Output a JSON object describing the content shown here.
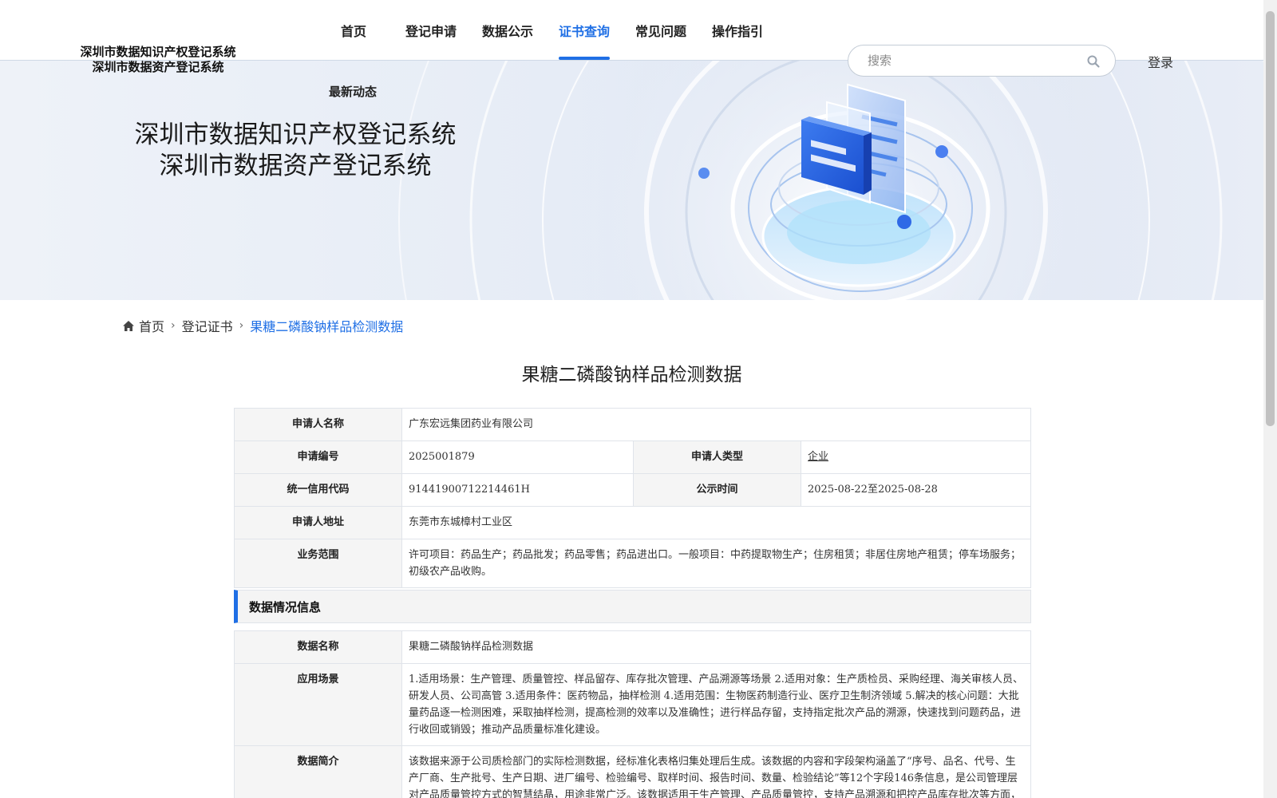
{
  "header": {
    "logo_line1": "深圳市数据知识产权登记系统",
    "logo_line2": "深圳市数据资产登记系统",
    "nav": [
      "首页",
      "登记申请",
      "数据公示",
      "证书查询",
      "常见问题",
      "操作指引"
    ],
    "nav_sub": "最新动态",
    "active_nav": "证书查询",
    "search_placeholder": "搜索",
    "login_label": "登录",
    "accent_color": "#1f6fe5"
  },
  "banner": {
    "title_line1": "深圳市数据知识产权登记系统",
    "title_line2": "深圳市数据资产登记系统"
  },
  "breadcrumb": {
    "home": "首页",
    "level2": "登记证书",
    "current": "果糖二磷酸钠样品检测数据"
  },
  "page_title": "果糖二磷酸钠样品检测数据",
  "applicant": {
    "name_label": "申请人名称",
    "name_value": "广东宏远集团药业有限公司",
    "number_label": "申请编号",
    "number_value": "2025001879",
    "type_label": "申请人类型",
    "type_value": "企业",
    "credit_label": "统一信用代码",
    "credit_value": "91441900712214461H",
    "publicity_label": "公示时间",
    "publicity_value": "2025-08-22至2025-08-28",
    "address_label": "申请人地址",
    "address_value": "东莞市东城樟村工业区",
    "scope_label": "业务范围",
    "scope_value": "许可项目：药品生产；药品批发；药品零售；药品进出口。一般项目：中药提取物生产；住房租赁；非居住房地产租赁；停车场服务；初级农产品收购。"
  },
  "data_section": {
    "heading": "数据情况信息",
    "name_label": "数据名称",
    "name_value": "果糖二磷酸钠样品检测数据",
    "scenario_label": "应用场景",
    "scenario_value": "1.适用场景：生产管理、质量管控、样品留存、库存批次管理、产品溯源等场景 2.适用对象：生产质检员、采购经理、海关审核人员、研发人员、公司高管 3.适用条件：医药物品，抽样检测 4.适用范围：生物医药制造行业、医疗卫生制济领域 5.解决的核心问题：大批量药品逐一检测困难，采取抽样检测，提高检测的效率以及准确性；进行样品存留，支持指定批次产品的溯源，快速找到问题药品，进行收回或销毁；推动产品质量标准化建设。",
    "intro_label": "数据简介",
    "intro_value": "该数据来源于公司质检部门的实际检测数据，经标准化表格归集处理后生成。该数据的内容和字段架构涵盖了“序号、品名、代号、生产厂商、生产批号、生产日期、进厂编号、检验编号、取样时间、报告时间、数量、检验结论”等12个字段146条信息，是公司管理层对产品质量管控方式的智慧结晶，用途非常广泛。该数据适用于生产管理、产品质量管控，支持产品溯源和把控产品库存批次等方面，强有力地保障公司用药质量，降低客户投诉，增强品牌信誉，是公司重要的数据资产之一。"
  }
}
